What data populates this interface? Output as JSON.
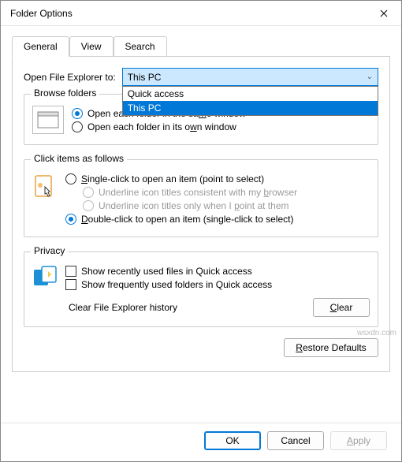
{
  "title": "Folder Options",
  "tabs": {
    "general": "General",
    "view": "View",
    "search": "Search"
  },
  "open_explorer": {
    "label": "Open File Explorer to:",
    "selected": "This PC",
    "options": [
      "Quick access",
      "This PC"
    ]
  },
  "browse": {
    "legend": "Browse folders",
    "same": "Open each folder in the same window",
    "own": "Open each folder in its own window"
  },
  "click": {
    "legend": "Click items as follows",
    "single": "Single-click to open an item (point to select)",
    "underline_browser": "Underline icon titles consistent with my browser",
    "underline_point": "Underline icon titles only when I point at them",
    "double": "Double-click to open an item (single-click to select)"
  },
  "privacy": {
    "legend": "Privacy",
    "recent_files": "Show recently used files in Quick access",
    "freq_folders": "Show frequently used folders in Quick access",
    "clear_label": "Clear File Explorer history",
    "clear_btn": "Clear"
  },
  "restore": "Restore Defaults",
  "buttons": {
    "ok": "OK",
    "cancel": "Cancel",
    "apply": "Apply"
  },
  "watermark": "wsxdn.com"
}
